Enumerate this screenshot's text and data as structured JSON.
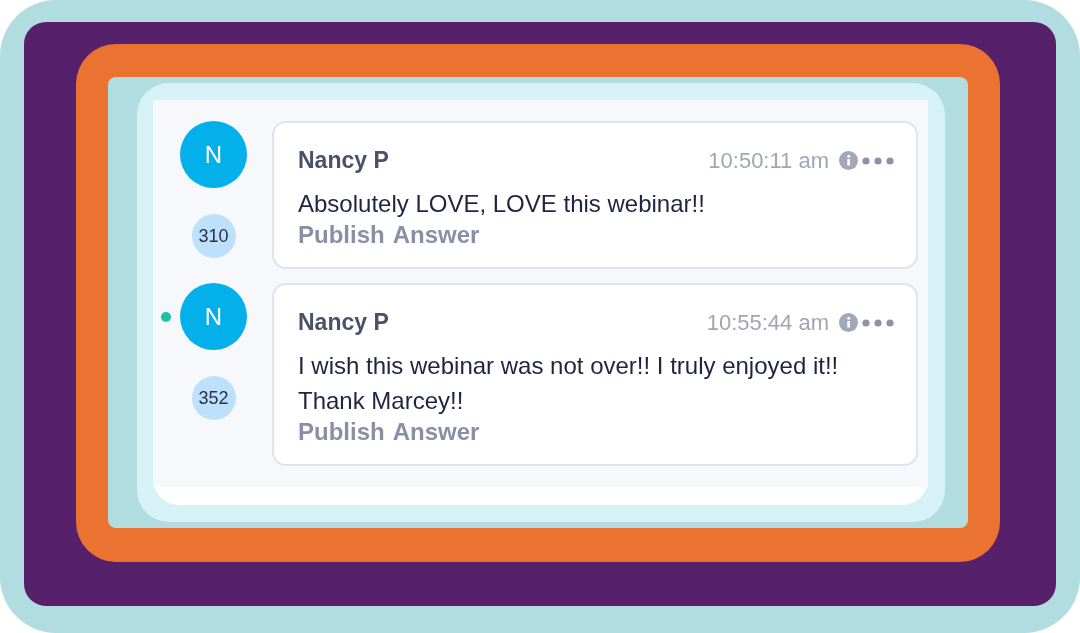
{
  "messages": [
    {
      "avatar_letter": "N",
      "count": "310",
      "online": false,
      "name": "Nancy P",
      "time": "10:50:11 am",
      "text": "Absolutely LOVE, LOVE this webinar!!",
      "actions": [
        "Publish",
        "Answer"
      ]
    },
    {
      "avatar_letter": "N",
      "count": "352",
      "online": true,
      "name": "Nancy P",
      "time": "10:55:44 am",
      "text": "I wish this webinar was not over!! I truly enjoyed it!! Thank Marcey!!",
      "actions": [
        "Publish",
        "Answer"
      ]
    }
  ]
}
